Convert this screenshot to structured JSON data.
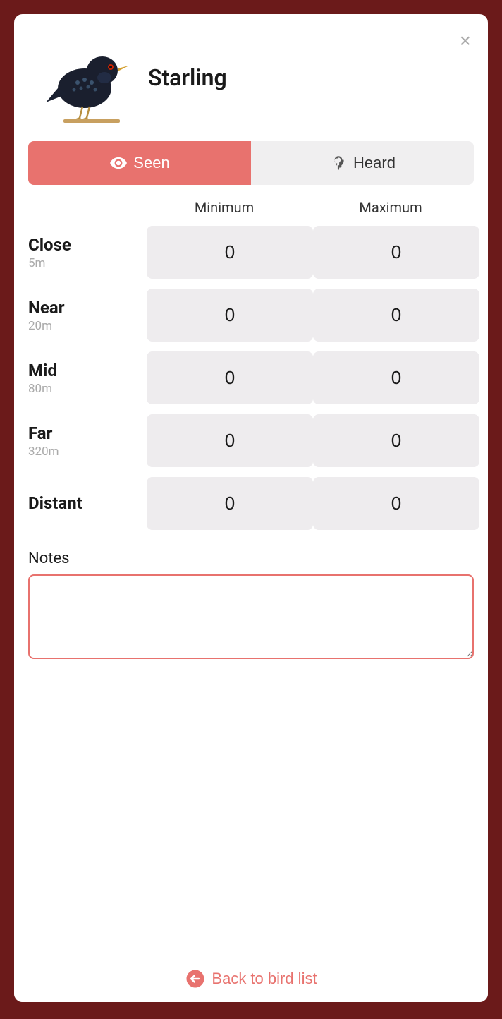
{
  "modal": {
    "title": "Starling",
    "close_label": "×",
    "tabs": {
      "seen_label": "Seen",
      "heard_label": "Heard"
    },
    "grid": {
      "col_min": "Minimum",
      "col_max": "Maximum",
      "rows": [
        {
          "label": "Close",
          "sublabel": "5m",
          "min": "0",
          "max": "0"
        },
        {
          "label": "Near",
          "sublabel": "20m",
          "min": "0",
          "max": "0"
        },
        {
          "label": "Mid",
          "sublabel": "80m",
          "min": "0",
          "max": "0"
        },
        {
          "label": "Far",
          "sublabel": "320m",
          "min": "0",
          "max": "0"
        },
        {
          "label": "Distant",
          "sublabel": "",
          "min": "0",
          "max": "0"
        }
      ]
    },
    "notes": {
      "label": "Notes",
      "placeholder": "",
      "value": ""
    },
    "back_label": "Back to bird list"
  },
  "colors": {
    "accent": "#e8726e",
    "tab_active_bg": "#e8726e",
    "tab_inactive_bg": "#f0eff0",
    "count_box_bg": "#eeecee"
  }
}
